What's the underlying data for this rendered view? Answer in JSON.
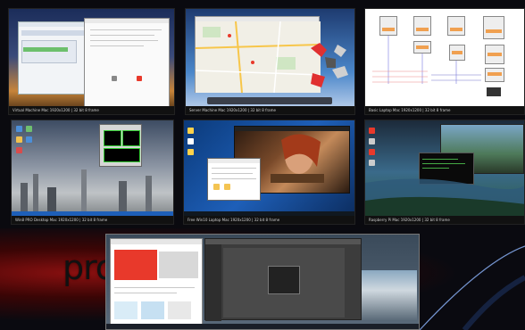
{
  "desktop": {
    "wallpaper_text": "pro"
  },
  "tiles": [
    {
      "status": "Virtual Machine   Mac   1920x1200 | 32 bit   8 frame"
    },
    {
      "status": "Server Machine   Mac   1920x1200 | 32 bit   8 frame"
    },
    {
      "status": "Basic Laptop   Mac   1920x1200 | 32 bit   8 frame"
    },
    {
      "status": "Win8 PRO Desktop   Mac   1920x1200 | 32 bit   8 frame"
    },
    {
      "status": "Free Win10 Laptop   Mac   1920x1200 | 32 bit   8 frame"
    },
    {
      "status": "Raspberry Pi   Mac   1920x1200 | 32 bit   8 frame"
    }
  ],
  "colors": {
    "accent_red": "#e8392b",
    "win_blue": "#1e5fb8",
    "mac_dock": "#3a3f4a"
  }
}
